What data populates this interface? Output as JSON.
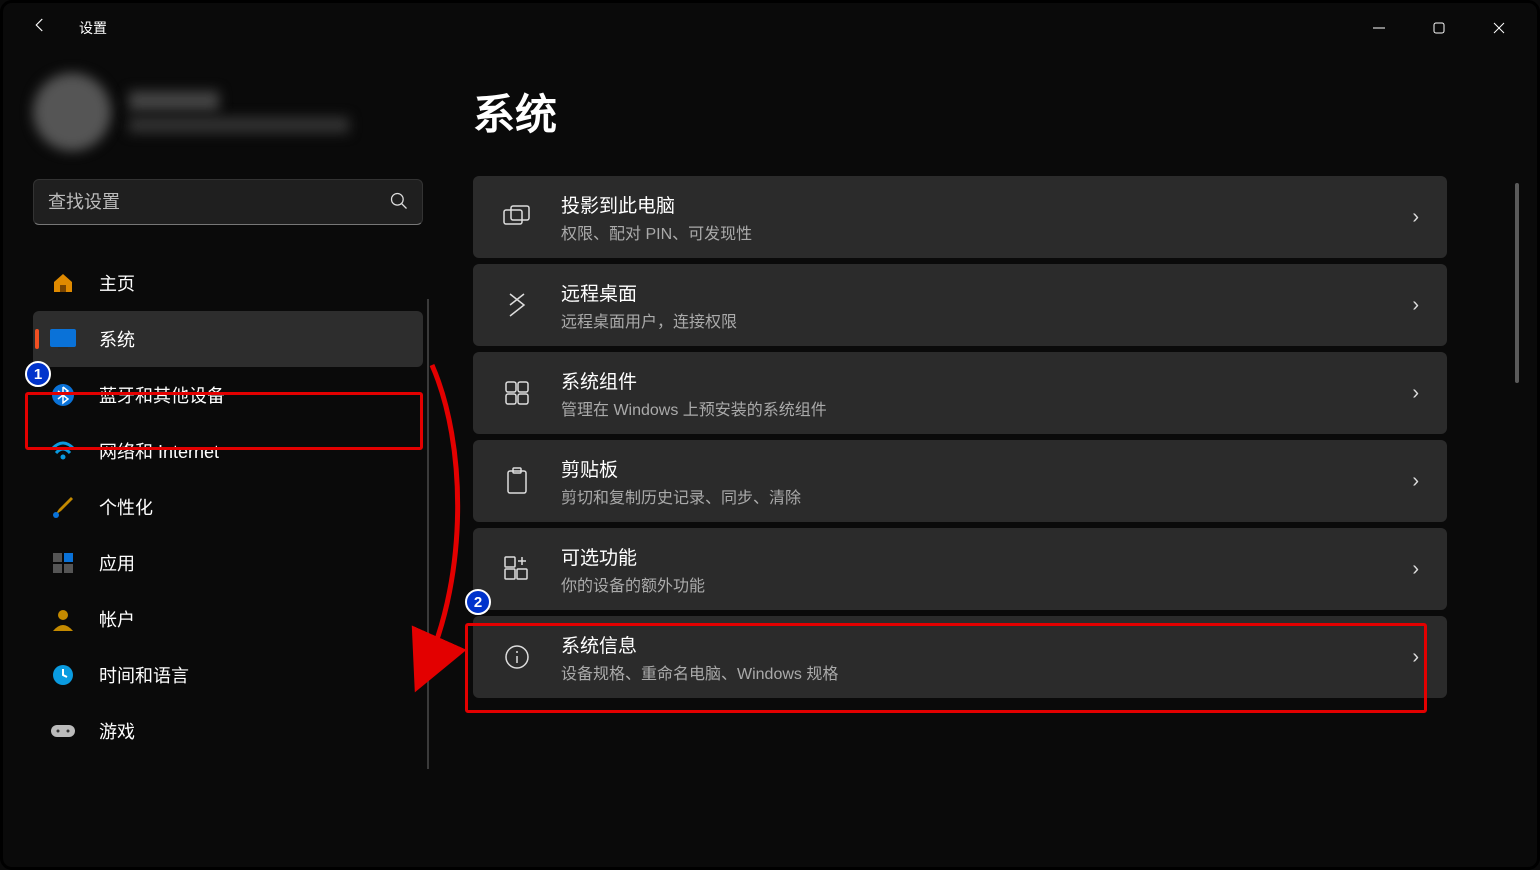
{
  "app_title": "设置",
  "search": {
    "placeholder": "查找设置"
  },
  "sidebar": {
    "items": [
      {
        "label": "主页"
      },
      {
        "label": "系统"
      },
      {
        "label": "蓝牙和其他设备"
      },
      {
        "label": "网络和 Internet"
      },
      {
        "label": "个性化"
      },
      {
        "label": "应用"
      },
      {
        "label": "帐户"
      },
      {
        "label": "时间和语言"
      },
      {
        "label": "游戏"
      }
    ]
  },
  "main": {
    "title": "系统",
    "cards": [
      {
        "title": "投影到此电脑",
        "sub": "权限、配对 PIN、可发现性"
      },
      {
        "title": "远程桌面",
        "sub": "远程桌面用户，连接权限"
      },
      {
        "title": "系统组件",
        "sub": "管理在 Windows 上预安装的系统组件"
      },
      {
        "title": "剪贴板",
        "sub": "剪切和复制历史记录、同步、清除"
      },
      {
        "title": "可选功能",
        "sub": "你的设备的额外功能"
      },
      {
        "title": "系统信息",
        "sub": "设备规格、重命名电脑、Windows 规格"
      }
    ]
  },
  "annotations": {
    "badge1": "1",
    "badge2": "2"
  }
}
